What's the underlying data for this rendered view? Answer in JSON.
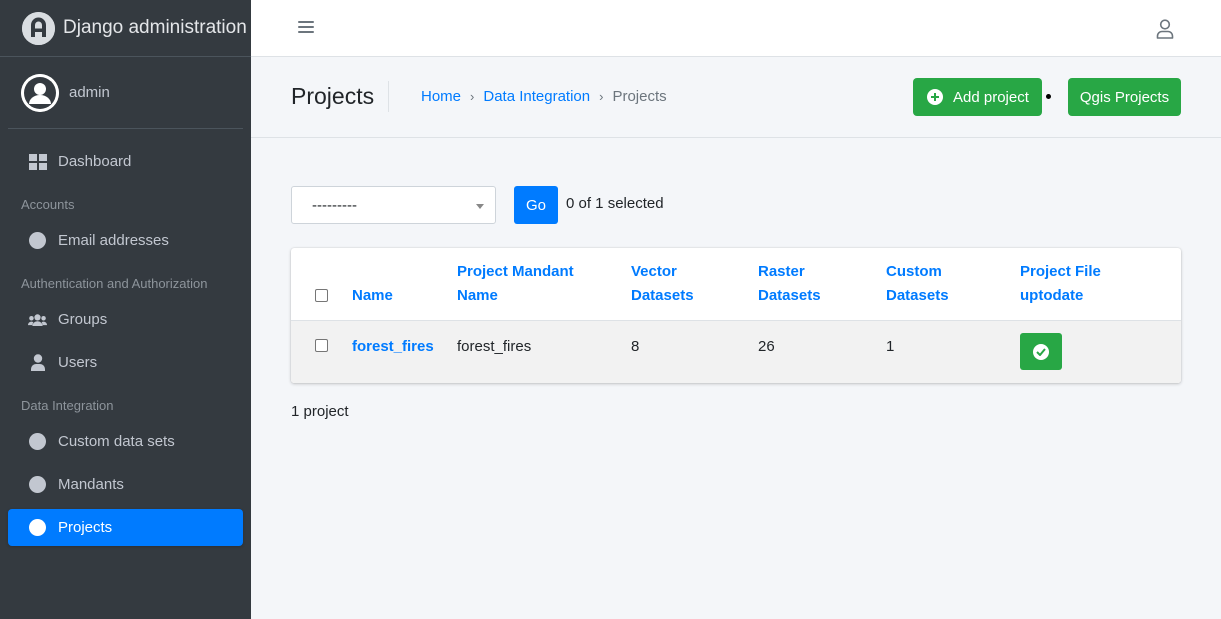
{
  "brand": {
    "title": "Django administration"
  },
  "user": {
    "name": "admin"
  },
  "sidebar": {
    "dashboard": "Dashboard",
    "sections": [
      {
        "header": "Accounts",
        "items": [
          "Email addresses"
        ]
      },
      {
        "header": "Authentication and Authorization",
        "items": [
          "Groups",
          "Users"
        ]
      },
      {
        "header": "Data Integration",
        "items": [
          "Custom data sets",
          "Mandants",
          "Projects"
        ]
      }
    ],
    "active_item": "Projects"
  },
  "header": {
    "title": "Projects",
    "breadcrumb": [
      "Home",
      "Data Integration",
      "Projects"
    ],
    "add_button": "Add project",
    "qgis_button": "Qgis Projects"
  },
  "actions": {
    "select_value": "---------",
    "go_label": "Go",
    "selected_text": "0 of 1 selected"
  },
  "table": {
    "columns": [
      {
        "line1": "Name",
        "line2": ""
      },
      {
        "line1": "Project Mandant",
        "line2": "Name"
      },
      {
        "line1": "Vector",
        "line2": "Datasets"
      },
      {
        "line1": "Raster",
        "line2": "Datasets"
      },
      {
        "line1": "Custom",
        "line2": "Datasets"
      },
      {
        "line1": "Project File",
        "line2": "uptodate"
      }
    ],
    "rows": [
      {
        "name": "forest_fires",
        "mandant": "forest_fires",
        "vector": "8",
        "raster": "26",
        "custom": "1",
        "uptodate": true
      }
    ]
  },
  "footer": {
    "count_text": "1 project"
  },
  "colors": {
    "sidebar": "#343a40",
    "primary": "#007bff",
    "success": "#28a745"
  }
}
